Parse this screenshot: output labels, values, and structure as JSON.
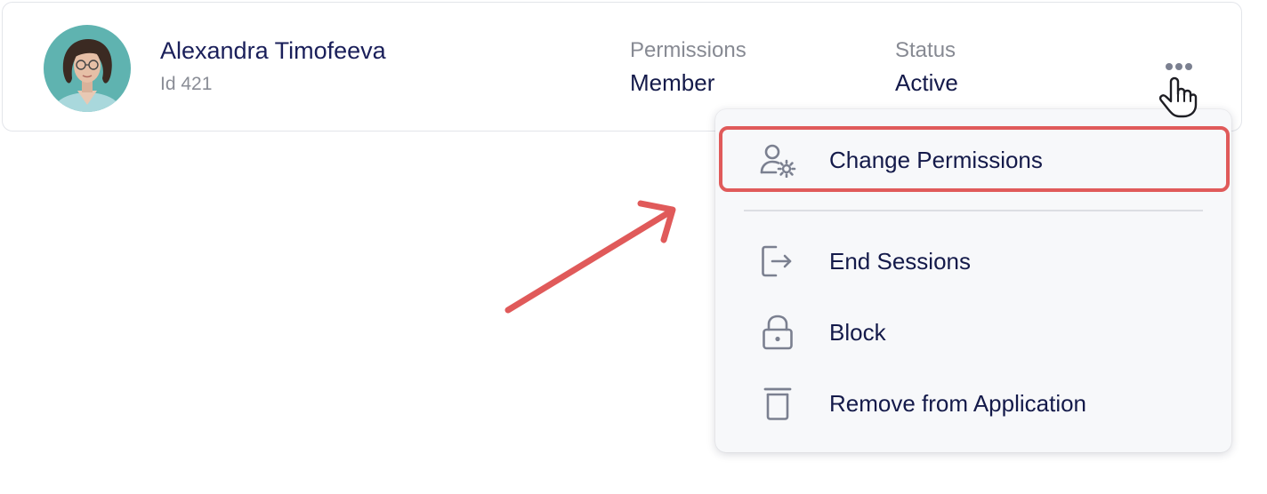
{
  "user": {
    "name": "Alexandra Timofeeva",
    "id_label": "Id 421",
    "permissions_label": "Permissions",
    "permissions_value": "Member",
    "status_label": "Status",
    "status_value": "Active"
  },
  "menu": {
    "items": [
      {
        "label": "Change Permissions",
        "icon": "user-gear-icon"
      },
      {
        "label": "End Sessions",
        "icon": "logout-icon"
      },
      {
        "label": "Block",
        "icon": "lock-icon"
      },
      {
        "label": "Remove from Application",
        "icon": "trash-icon"
      }
    ]
  },
  "colors": {
    "accent_highlight": "#e05a5a",
    "text_primary": "#141a4a",
    "text_secondary": "#878a93",
    "icon_gray": "#7b8090",
    "menu_background": "#f7f8fa"
  }
}
